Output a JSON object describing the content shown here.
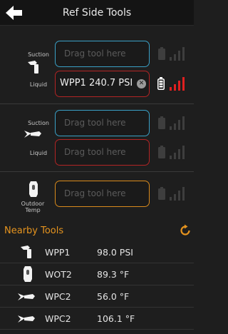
{
  "header": {
    "title": "Ref Side Tools",
    "back_icon": "left-arrow-icon"
  },
  "groups": [
    {
      "labels": {
        "suction": "Suction",
        "liquid": "Liquid"
      },
      "icon": "pressure-probe-icon",
      "suction_slot": {
        "placeholder": "Drag tool here"
      },
      "liquid_slot": {
        "tool": "WPP1",
        "reading": "240.7 PSI"
      }
    },
    {
      "labels": {
        "suction": "Suction",
        "liquid": "Liquid"
      },
      "icon": "clamp-thermometer-icon",
      "suction_slot": {
        "placeholder": "Drag tool here"
      },
      "liquid_slot": {
        "placeholder": "Drag tool here"
      }
    },
    {
      "labels": {
        "outdoor": "Outdoor",
        "temp": "Temp"
      },
      "icon": "outdoor-temp-probe-icon",
      "slot": {
        "placeholder": "Drag tool here"
      }
    }
  ],
  "nearby": {
    "title": "Nearby Tools",
    "refresh_icon": "refresh-icon",
    "items": [
      {
        "name": "WPP1",
        "value": "98.0 PSI",
        "icon": "pressure-probe-icon"
      },
      {
        "name": "WOT2",
        "value": "89.3 °F",
        "icon": "outdoor-temp-probe-icon"
      },
      {
        "name": "WPC2",
        "value": "56.0 °F",
        "icon": "clamp-thermometer-icon"
      },
      {
        "name": "WPC2",
        "value": "106.1 °F",
        "icon": "clamp-thermometer-icon"
      }
    ]
  },
  "colors": {
    "accent_orange": "#e6941e",
    "slot_blue": "#3aa0c6",
    "slot_red": "#b32424",
    "signal_red": "#e02020",
    "inactive_gray": "#3e3e3e"
  },
  "status": {
    "active_battery_level": 0.8,
    "active_signal_bars": 4,
    "inactive_signal_bars": 0
  }
}
